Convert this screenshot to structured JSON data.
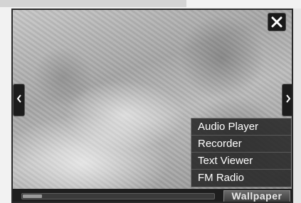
{
  "menu": {
    "items": [
      {
        "label": "Audio Player"
      },
      {
        "label": "Recorder"
      },
      {
        "label": "Text Viewer"
      },
      {
        "label": "FM Radio"
      }
    ]
  },
  "bottom_bar": {
    "wallpaper_label": "Wallpaper",
    "progress_fraction": 0.1
  },
  "icons": {
    "close": "close-icon",
    "prev": "chevron-left-icon",
    "next": "chevron-right-icon"
  },
  "colors": {
    "bar": "#1e1e1e",
    "menu_bg": "#282828",
    "text": "#ffffff"
  }
}
